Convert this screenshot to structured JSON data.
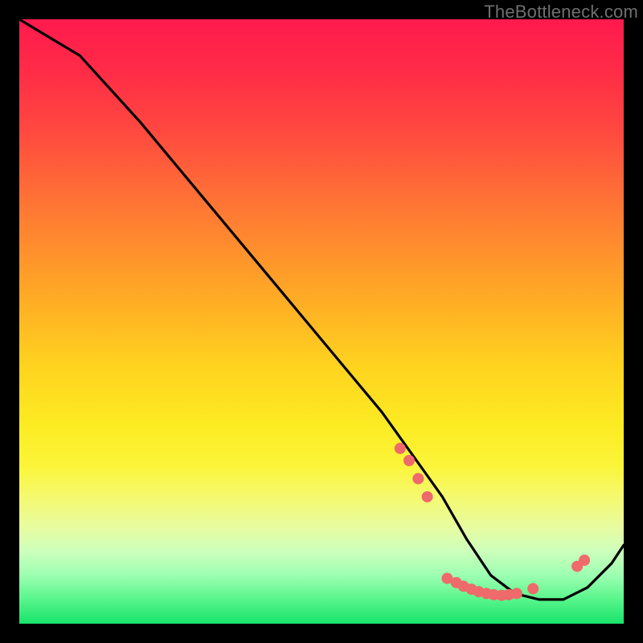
{
  "watermark": "TheBottleneck.com",
  "chart_data": {
    "type": "line",
    "title": "",
    "xlabel": "",
    "ylabel": "",
    "xlim": [
      0,
      100
    ],
    "ylim": [
      0,
      100
    ],
    "note": "Axes are normalized 0–100 because the figure has no visible tick labels; values are read proportionally from the plot area.",
    "series": [
      {
        "name": "curve",
        "x": [
          0,
          5,
          10,
          20,
          30,
          40,
          50,
          60,
          65,
          70,
          74,
          78,
          82,
          86,
          90,
          94,
          98,
          100
        ],
        "y": [
          100,
          97,
          94,
          83,
          71,
          59,
          47,
          35,
          28,
          21,
          14,
          8,
          5,
          4,
          4,
          6,
          10,
          13
        ]
      }
    ],
    "dots": {
      "name": "highlight-points",
      "color": "#ef6a6a",
      "points": [
        {
          "x": 63.0,
          "y": 29.0
        },
        {
          "x": 64.5,
          "y": 27.0
        },
        {
          "x": 66.0,
          "y": 24.0
        },
        {
          "x": 67.5,
          "y": 21.0
        },
        {
          "x": 70.8,
          "y": 7.5
        },
        {
          "x": 72.3,
          "y": 6.8
        },
        {
          "x": 73.5,
          "y": 6.2
        },
        {
          "x": 74.8,
          "y": 5.7
        },
        {
          "x": 76.0,
          "y": 5.3
        },
        {
          "x": 77.3,
          "y": 5.0
        },
        {
          "x": 78.5,
          "y": 4.8
        },
        {
          "x": 79.8,
          "y": 4.7
        },
        {
          "x": 81.0,
          "y": 4.8
        },
        {
          "x": 82.3,
          "y": 5.0
        },
        {
          "x": 85.0,
          "y": 5.8
        },
        {
          "x": 92.3,
          "y": 9.5
        },
        {
          "x": 93.5,
          "y": 10.5
        }
      ]
    }
  }
}
